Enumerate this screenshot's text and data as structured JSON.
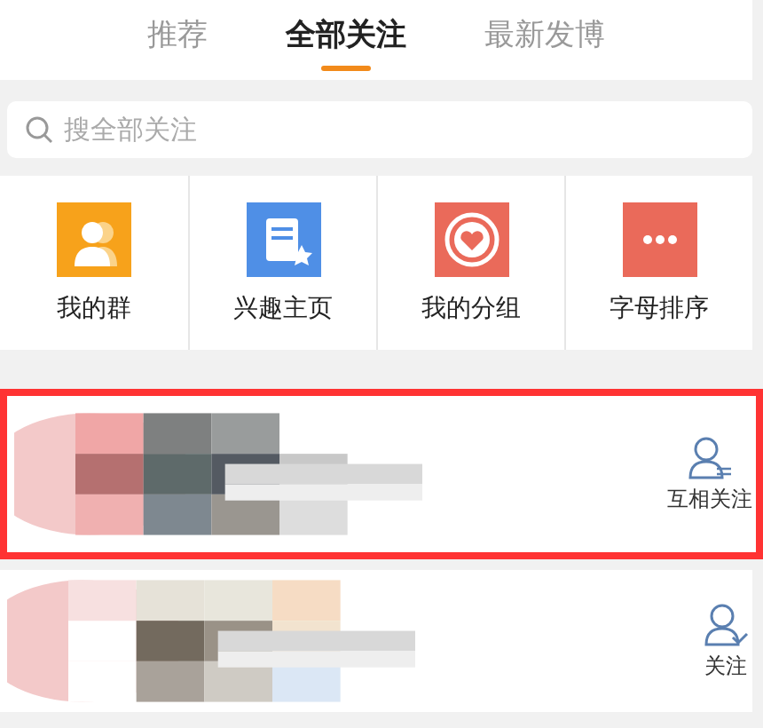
{
  "tabs": [
    {
      "label": "推荐",
      "selected": false
    },
    {
      "label": "全部关注",
      "selected": true
    },
    {
      "label": "最新发博",
      "selected": false
    }
  ],
  "search": {
    "placeholder": "搜全部关注"
  },
  "shortcuts": [
    {
      "label": "我的群",
      "kind": "group"
    },
    {
      "label": "兴趣主页",
      "kind": "interest"
    },
    {
      "label": "我的分组",
      "kind": "heart"
    },
    {
      "label": "字母排序",
      "kind": "more"
    }
  ],
  "users": [
    {
      "kind": "mutual",
      "relation": "互相关注",
      "highlighted": true
    },
    {
      "kind": "following",
      "relation": "关注",
      "highlighted": false
    }
  ]
}
